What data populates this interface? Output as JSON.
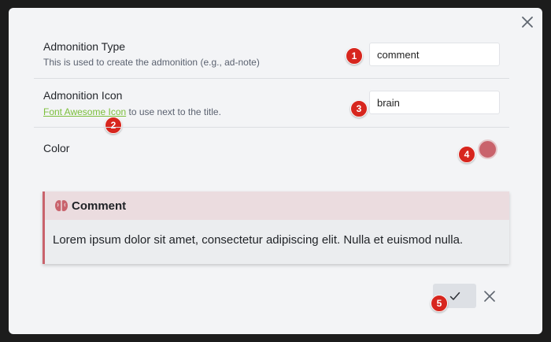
{
  "form": {
    "type": {
      "label": "Admonition Type",
      "description": "This is used to create the admonition (e.g., ad-note)",
      "value": "comment"
    },
    "icon": {
      "label": "Admonition Icon",
      "link_text": "Font Awesome Icon",
      "description_suffix": " to use next to the title.",
      "value": "brain"
    },
    "color": {
      "label": "Color",
      "value": "#c9636c"
    }
  },
  "preview": {
    "icon": "brain-icon",
    "title": "Comment",
    "body": "Lorem ipsum dolor sit amet, consectetur adipiscing elit. Nulla et euismod nulla."
  },
  "callouts": [
    "1",
    "2",
    "3",
    "4",
    "5"
  ],
  "actions": {
    "confirm_icon": "check-icon",
    "cancel_icon": "close-icon"
  },
  "colors": {
    "accent": "#c9636c",
    "link": "#7cbf3c",
    "badge": "#d7261e"
  }
}
